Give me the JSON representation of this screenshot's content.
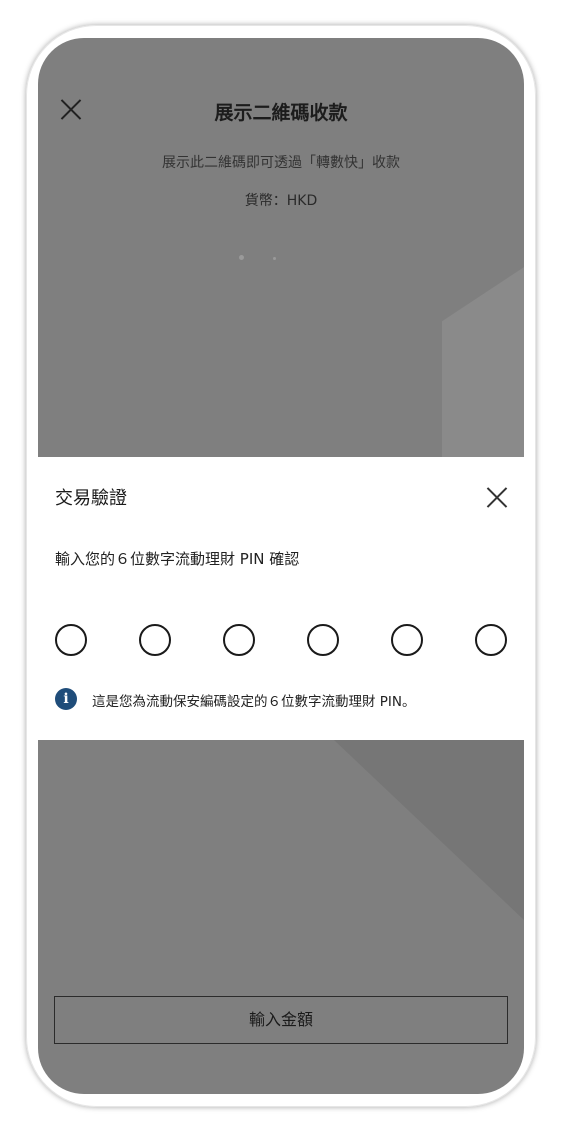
{
  "header": {
    "title": "展示二維碼收款",
    "close_icon": "close-icon"
  },
  "qr_page": {
    "instruction": "展示此二維碼即可透過「轉數快」收款",
    "currency_text": "貨幣：HKD"
  },
  "verification_sheet": {
    "title": "交易驗證",
    "close_icon": "close-icon",
    "prompt": "輸入您的６位數字流動理財 PIN 確認",
    "pin_length": 6,
    "info_icon": "info-icon",
    "info_text": "這是您為流動保安編碼設定的６位數字流動理財 PIN。"
  },
  "footer": {
    "enter_amount_label": "輸入金額"
  },
  "colors": {
    "overlay_background": "#7f7f7f",
    "sheet_background": "#ffffff",
    "info_icon": "#1f4d7a",
    "text": "#1a1a1a"
  }
}
